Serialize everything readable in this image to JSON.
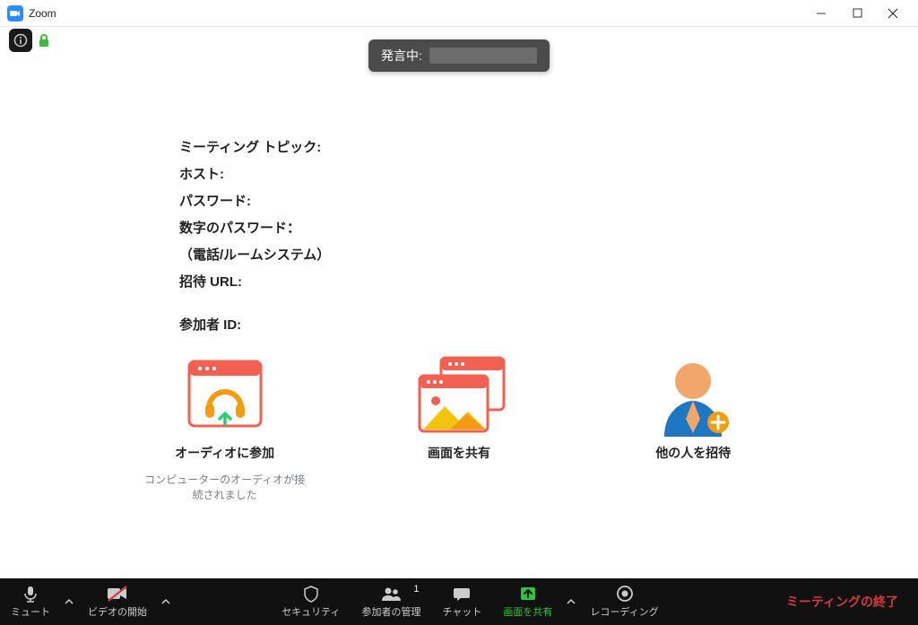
{
  "window": {
    "title": "Zoom"
  },
  "speaking": {
    "label": "発言中:"
  },
  "info": {
    "topic_label": "ミーティング トピック:",
    "host_label": "ホスト:",
    "password_label": "パスワード:",
    "numeric_password_label": "数字のパスワード：",
    "numeric_password_sub": "（電話/ルームシステム）",
    "invite_url_label": "招待 URL:",
    "participant_id_label": "参加者 ID:"
  },
  "tiles": {
    "audio": {
      "label": "オーディオに参加",
      "sub": "コンピューターのオーディオが接続されました"
    },
    "share": {
      "label": "画面を共有"
    },
    "invite": {
      "label": "他の人を招待"
    }
  },
  "toolbar": {
    "mute": "ミュート",
    "video": "ビデオの開始",
    "security": "セキュリティ",
    "participants": "参加者の管理",
    "participants_count": "1",
    "chat": "チャット",
    "share": "画面を共有",
    "record": "レコーディング",
    "end": "ミーティングの終了"
  },
  "colors": {
    "share_green": "#33c33c",
    "end_red": "#d43b3b",
    "tile_red": "#f16051",
    "tile_orange": "#f39c11",
    "tile_yellow": "#f1c40f",
    "tile_green": "#2ecc71",
    "person_blue": "#1f77c4",
    "person_skin": "#f1a66a"
  }
}
